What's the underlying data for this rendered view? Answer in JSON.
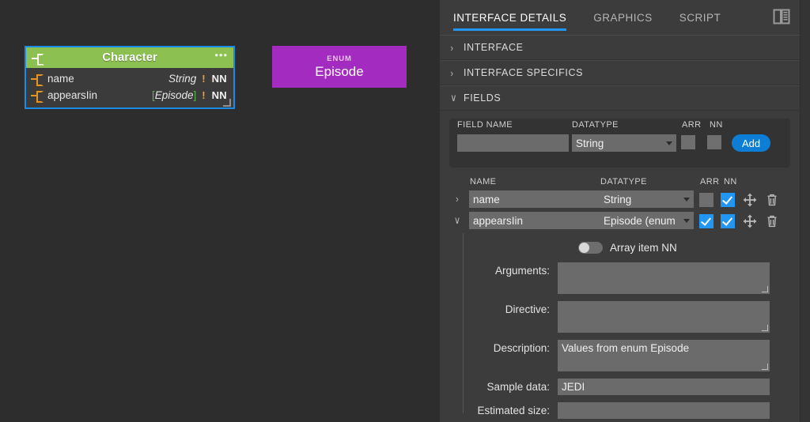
{
  "canvas": {
    "character_node": {
      "title": "Character",
      "menu_glyph": "•••",
      "fields": [
        {
          "name": "name",
          "type": "String",
          "bracket_open": "",
          "bracket_close": "",
          "required": "!",
          "nn": "NN"
        },
        {
          "name": "appearsIin",
          "type": "Episode",
          "bracket_open": "[",
          "bracket_close": "]",
          "required": "!",
          "nn": "NN"
        }
      ]
    },
    "enum_node": {
      "kind": "ENUM",
      "name": "Episode"
    }
  },
  "panel": {
    "tabs": [
      {
        "label": "INTERFACE DETAILS",
        "active": true
      },
      {
        "label": "GRAPHICS",
        "active": false
      },
      {
        "label": "SCRIPT",
        "active": false
      }
    ],
    "panel_toggle_icon": "split-pane-icon",
    "sections": [
      {
        "label": "INTERFACE",
        "chevron": "›",
        "expanded": false
      },
      {
        "label": "INTERFACE SPECIFICS",
        "chevron": "›",
        "expanded": false
      },
      {
        "label": "FIELDS",
        "chevron": "∨",
        "expanded": true
      }
    ],
    "add_field": {
      "field_name_header": "FIELD NAME",
      "datatype_header": "DATATYPE",
      "arr_header": "ARR",
      "nn_header": "NN",
      "field_name_value": "",
      "field_name_placeholder": "",
      "datatype_value": "String",
      "arr_checked": false,
      "nn_checked": false,
      "add_label": "Add"
    },
    "fields_table": {
      "headers": {
        "name": "NAME",
        "datatype": "DATATYPE",
        "arr": "ARR",
        "nn": "NN"
      },
      "rows": [
        {
          "chevron": "›",
          "expanded": false,
          "name": "name",
          "datatype": "String",
          "arr_checked": false,
          "nn_checked": true,
          "move_icon": "move-icon",
          "delete_icon": "trash-icon"
        },
        {
          "chevron": "∨",
          "expanded": true,
          "name": "appearsIin",
          "datatype": "Episode (enum",
          "arr_checked": true,
          "nn_checked": true,
          "move_icon": "move-icon",
          "delete_icon": "trash-icon"
        }
      ]
    },
    "field_detail": {
      "array_item_nn_label": "Array item NN",
      "array_item_nn_on": false,
      "arguments_label": "Arguments:",
      "arguments_value": "",
      "directive_label": "Directive:",
      "directive_value": "",
      "description_label": "Description:",
      "description_value": "Values from enum Episode",
      "sample_data_label": "Sample data:",
      "sample_data_value": "JEDI",
      "estimated_size_label": "Estimated size:",
      "estimated_size_value": ""
    }
  },
  "colors": {
    "accent_blue": "#2196f3",
    "node_header_green": "#8cc152",
    "enum_purple": "#a42bc0",
    "selection_blue": "#1b8ce3",
    "port_orange": "#e8921f",
    "bracket_green": "#57b94a",
    "canvas_bg": "#2d2d2d",
    "panel_bg": "#3c3c3c"
  }
}
